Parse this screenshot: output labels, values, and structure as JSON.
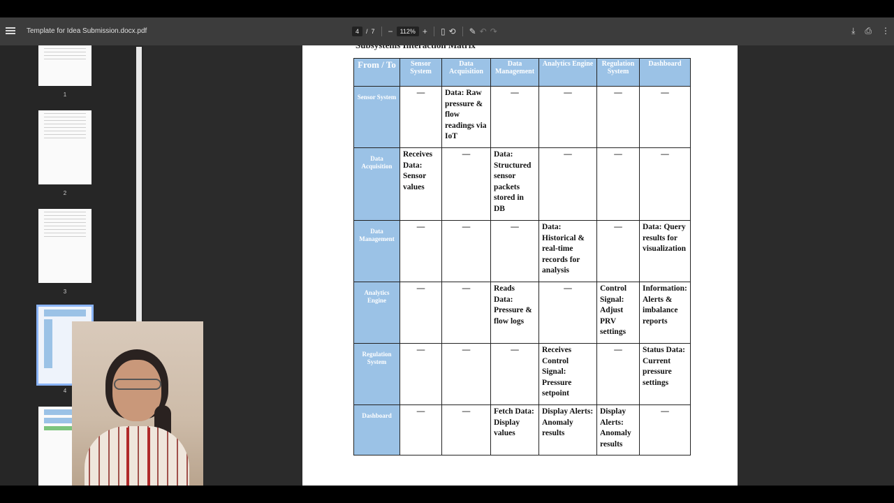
{
  "toolbar": {
    "title": "Template for Idea Submission.docx.pdf",
    "current_page": "4",
    "page_sep": "/",
    "total_pages": "7",
    "zoom": "112%",
    "zoom_out": "−",
    "zoom_in": "+"
  },
  "thumbnails": [
    {
      "label": "1"
    },
    {
      "label": "2"
    },
    {
      "label": "3"
    },
    {
      "label": "4"
    },
    {
      "label": ""
    }
  ],
  "document": {
    "heading": "Subsystems Interaction Matrix",
    "matrix": {
      "corner": "From / To",
      "columns": [
        "Sensor System",
        "Data Acquisition",
        "Data Management",
        "Analytics Engine",
        "Regulation System",
        "Dashboard"
      ],
      "rows": [
        {
          "label": "Sensor System",
          "cells": [
            "—",
            "Data: Raw pressure & flow readings via IoT",
            "—",
            "—",
            "—",
            "—"
          ]
        },
        {
          "label": "Data Acquisition",
          "cells": [
            "Receives Data: Sensor values",
            "—",
            "Data: Structured sensor packets stored in DB",
            "—",
            "—",
            "—"
          ]
        },
        {
          "label": "Data Management",
          "cells": [
            "—",
            "—",
            "—",
            "Data: Historical & real-time records for analysis",
            "—",
            "Data: Query results for visualization"
          ]
        },
        {
          "label": "Analytics Engine",
          "cells": [
            "—",
            "—",
            "Reads Data: Pressure & flow logs",
            "—",
            "Control Signal: Adjust PRV settings",
            "Information: Alerts & imbalance reports"
          ]
        },
        {
          "label": "Regulation System",
          "cells": [
            "—",
            "—",
            "—",
            "Receives Control Signal: Pressure setpoint",
            "—",
            "Status Data: Current pressure settings"
          ]
        },
        {
          "label": "Dashboard",
          "cells": [
            "—",
            "—",
            "Fetch Data: Display values",
            "Display Alerts: Anomaly results",
            "Display Alerts: Anomaly results",
            "—"
          ]
        }
      ]
    }
  }
}
